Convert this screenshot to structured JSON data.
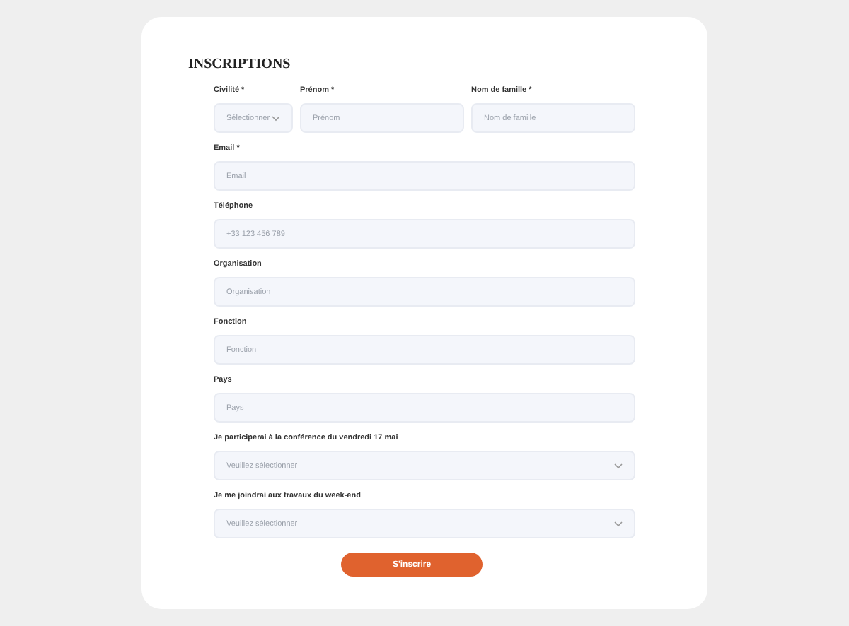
{
  "form": {
    "title": "INSCRIPTIONS",
    "name_row": [
      {
        "kind": "select",
        "label": "Civilité *",
        "placeholder": "Sélectionner"
      },
      {
        "kind": "text",
        "label": "Prénom *",
        "placeholder": "Prénom"
      },
      {
        "kind": "text",
        "label": "Nom de famille *",
        "placeholder": "Nom de famille"
      }
    ],
    "fields": [
      {
        "kind": "text",
        "label": "Email *",
        "placeholder": "Email"
      },
      {
        "kind": "text",
        "label": "Téléphone",
        "placeholder": "+33 123 456 789"
      },
      {
        "kind": "text",
        "label": "Organisation",
        "placeholder": "Organisation"
      },
      {
        "kind": "text",
        "label": "Fonction",
        "placeholder": "Fonction"
      },
      {
        "kind": "text",
        "label": "Pays",
        "placeholder": "Pays"
      },
      {
        "kind": "select",
        "label": "Je participerai à la conférence du vendredi 17 mai",
        "placeholder": "Veuillez sélectionner"
      },
      {
        "kind": "select",
        "label": "Je me joindrai aux travaux du week-end",
        "placeholder": "Veuillez sélectionner"
      }
    ],
    "submit": "S'inscrire"
  }
}
